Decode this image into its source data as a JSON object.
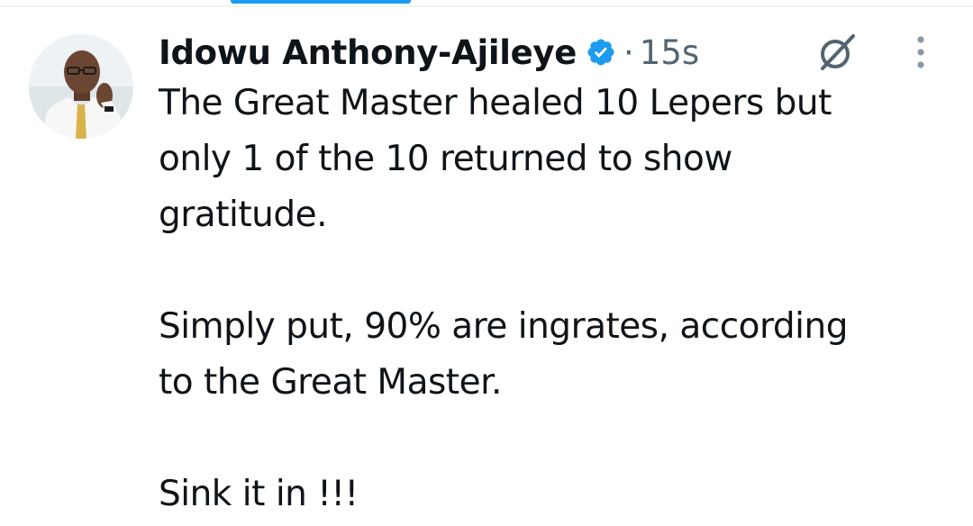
{
  "tweet": {
    "author": {
      "display_name": "Idowu Anthony-Ajileye",
      "verified_icon": "verified-badge-icon",
      "avatar": "author-avatar"
    },
    "separator": "·",
    "timestamp": "15s",
    "actions": {
      "grok_icon": "grok-icon",
      "more_icon": "more-options-icon"
    },
    "paragraphs": [
      {
        "lines": [
          "The Great Master healed 10 Lepers but",
          "only 1 of the 10 returned to show",
          "gratitude."
        ]
      },
      {
        "lines": [
          "Simply put, 90% are ingrates, according",
          "to the Great Master."
        ]
      },
      {
        "lines": [
          "Sink it in !!!"
        ]
      }
    ]
  },
  "colors": {
    "accent": "#1d9bf0",
    "text": "#0f1419",
    "muted": "#536471",
    "divider": "#eff3f4"
  }
}
